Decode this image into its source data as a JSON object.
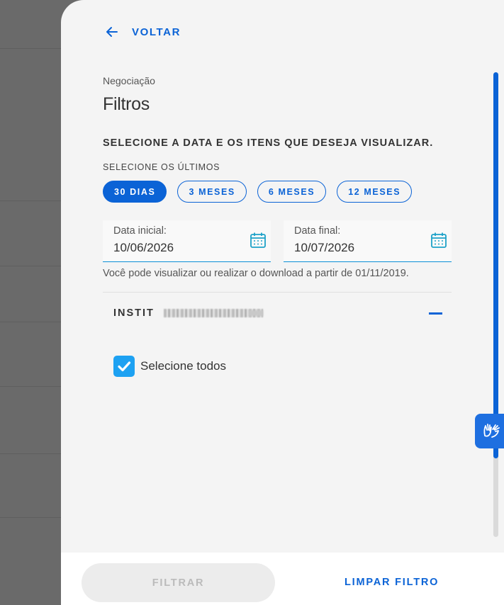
{
  "header": {
    "back_label": "VOLTAR"
  },
  "eyebrow": "Negociação",
  "title": "Filtros",
  "instruction": "SELECIONE A DATA E OS ITENS QUE DESEJA VISUALIZAR.",
  "period": {
    "label": "SELECIONE OS ÚLTIMOS",
    "options": [
      "30 DIAS",
      "3 MESES",
      "6 MESES",
      "12 MESES"
    ],
    "selected": "30 DIAS"
  },
  "dates": {
    "start_label": "Data inicial:",
    "start_value": "10/06/2026",
    "end_label": "Data final:",
    "end_value": "10/07/2026"
  },
  "hint": "Você pode visualizar ou realizar o download a partir de 01/11/2019.",
  "institution": {
    "title": "INSTIT"
  },
  "select_all": {
    "label": "Selecione todos",
    "checked": true
  },
  "footer": {
    "filter_label": "FILTRAR",
    "clear_label": "LIMPAR FILTRO"
  },
  "colors": {
    "accent": "#0b63d6",
    "checkbox": "#1da1f2",
    "a11y": "#1e6fe0"
  },
  "icons": [
    "arrow-left-icon",
    "calendar-icon",
    "minus-icon",
    "check-icon",
    "hand-sign-icon"
  ]
}
